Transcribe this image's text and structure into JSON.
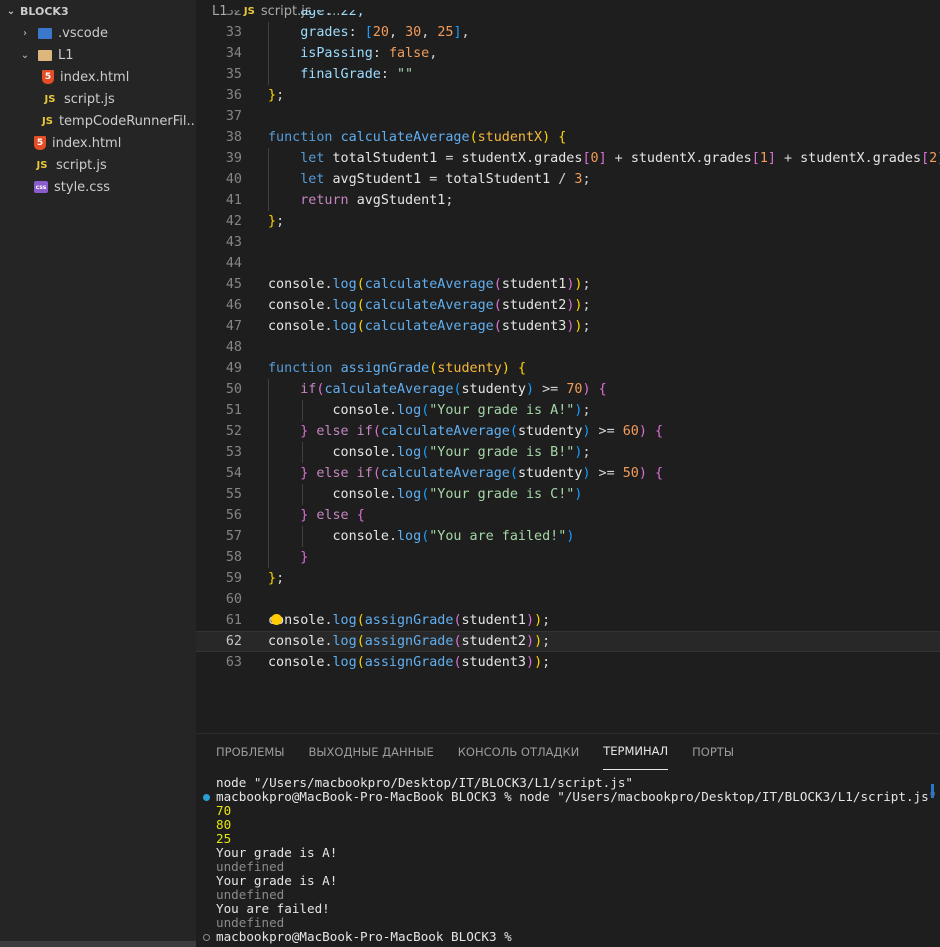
{
  "explorer": {
    "root": "BLOCK3",
    "items": [
      {
        "name": ".vscode",
        "icon": "vscode-folder-icon"
      },
      {
        "name": "L1",
        "icon": "folder-icon"
      },
      {
        "name": "index.html",
        "icon": "html5-icon"
      },
      {
        "name": "script.js",
        "icon": "js-icon"
      },
      {
        "name": "tempCodeRunnerFil...",
        "icon": "js-icon"
      },
      {
        "name": "index.html",
        "icon": "html5-icon"
      },
      {
        "name": "script.js",
        "icon": "js-icon"
      },
      {
        "name": "style.css",
        "icon": "css-icon"
      }
    ]
  },
  "breadcrumb": {
    "folder": "L1",
    "file": "script.js",
    "ellipsis": "..."
  },
  "editor": {
    "line_numbers": [
      "32",
      "33",
      "34",
      "35",
      "36",
      "37",
      "38",
      "39",
      "40",
      "41",
      "42",
      "43",
      "44",
      "45",
      "46",
      "47",
      "48",
      "49",
      "50",
      "51",
      "52",
      "53",
      "54",
      "55",
      "56",
      "57",
      "58",
      "59",
      "60",
      "61",
      "62",
      "63"
    ],
    "current_line": "62",
    "top_partial": "age: 22,"
  },
  "panel": {
    "tabs": [
      "ПРОБЛЕМЫ",
      "ВЫХОДНЫЕ ДАННЫЕ",
      "КОНСОЛЬ ОТЛАДКИ",
      "ТЕРМИНАЛ",
      "ПОРТЫ"
    ],
    "active_tab": "ТЕРМИНАЛ",
    "terminal": [
      {
        "text": "node \"/Users/macbookpro/Desktop/IT/BLOCK3/L1/script.js\"",
        "style": "normal",
        "marker": ""
      },
      {
        "text": "macbookpro@MacBook-Pro-MacBook BLOCK3 % node \"/Users/macbookpro/Desktop/IT/BLOCK3/L1/script.js\"",
        "style": "normal",
        "marker": "blue"
      },
      {
        "text": "70",
        "style": "yellow",
        "marker": ""
      },
      {
        "text": "80",
        "style": "yellow",
        "marker": ""
      },
      {
        "text": "25",
        "style": "yellow",
        "marker": ""
      },
      {
        "text": "Your grade is A!",
        "style": "normal",
        "marker": ""
      },
      {
        "text": "undefined",
        "style": "dim",
        "marker": ""
      },
      {
        "text": "Your grade is A!",
        "style": "normal",
        "marker": ""
      },
      {
        "text": "undefined",
        "style": "dim",
        "marker": ""
      },
      {
        "text": "You are failed!",
        "style": "normal",
        "marker": ""
      },
      {
        "text": "undefined",
        "style": "dim",
        "marker": ""
      },
      {
        "text": "macbookpro@MacBook-Pro-MacBook BLOCK3 % ",
        "style": "normal",
        "marker": "hollow"
      }
    ]
  },
  "colors": {
    "sidebar_bg": "#252526",
    "editor_bg": "#1e1e1e",
    "keyword": "#c586c0",
    "function_keyword": "#569cd6",
    "function_name": "#dcdcaa",
    "number": "#f39c5a",
    "string": "#a5d6a7",
    "terminal_yellow": "#e5e510"
  }
}
